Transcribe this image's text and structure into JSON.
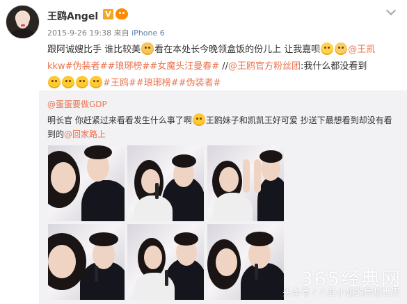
{
  "post": {
    "author": "王鸥Angel",
    "verified_badge": "V",
    "meta_date": "2015-9-26 19:38",
    "meta_from": "来自",
    "meta_device": "iPhone 6",
    "text": {
      "part1": "跟阿诚嫂比手 谁比较美",
      "part2": "看在本处长今晚领盒饭的份儿上 让我嘉呗",
      "mention1": "@王凯kkw",
      "tag1": "#伪装者#",
      "tag2": "#琅琊榜#",
      "tag3": "#女魔头汪曼春#",
      "separator": " //",
      "mention2": "@王鸥官方粉丝团",
      "part3": ":我什么都没看到",
      "tag4": "#王鸥#",
      "tag5": "#琅琊榜#",
      "tag6": "#伪装者#"
    }
  },
  "repost": {
    "author": "@蛋蛋要做GDP",
    "text1": "明长官 你赶紧过来看看发生什么事了啊",
    "text2": "王鸥妹子和凯凯王好可爱 抄送下最想看到却没有看到的",
    "mention": "@回家路上"
  },
  "watermarks": {
    "site": "365经典网",
    "source": "头条号 / 八卦小姐的异想世界"
  },
  "colors": {
    "link": "#eb7350",
    "repost_bg": "#f2f2f5",
    "meta": "#808080"
  },
  "icons": [
    "avatar",
    "verified-badge-icon",
    "member-icon",
    "chevron-down-icon",
    "emoji-icon",
    "photo"
  ]
}
